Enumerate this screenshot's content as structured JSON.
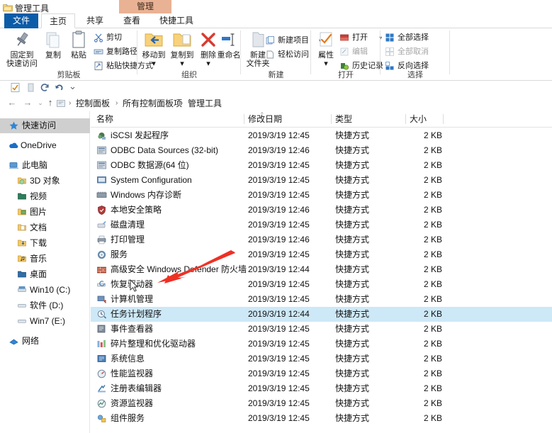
{
  "window": {
    "title": "管理工具",
    "icon": "folder-tools-icon",
    "contextual_tab_header": "管理",
    "contextual_tab_color": "#e9b294"
  },
  "ribbon": {
    "tabs": [
      {
        "label": "文件",
        "name": "tab-file",
        "state": "accent"
      },
      {
        "label": "主页",
        "name": "tab-home",
        "state": "active"
      },
      {
        "label": "共享",
        "name": "tab-share",
        "state": "normal"
      },
      {
        "label": "查看",
        "name": "tab-view",
        "state": "normal"
      },
      {
        "label": "快捷工具",
        "name": "tab-shortcut-tools",
        "state": "normal"
      }
    ],
    "groups": [
      {
        "label": "剪贴板",
        "big_buttons": [
          {
            "label_line1": "固定到",
            "label_line2": "快速访问",
            "icon": "pin-icon"
          },
          {
            "label_line1": "复制",
            "label_line2": "",
            "icon": "copy-icon"
          },
          {
            "label_line1": "粘贴",
            "label_line2": "",
            "icon": "paste-icon"
          }
        ],
        "small_buttons": [
          {
            "label": "剪切",
            "icon": "scissors-icon",
            "disabled": false
          },
          {
            "label": "复制路径",
            "icon": "copy-path-icon",
            "disabled": false
          },
          {
            "label": "粘贴快捷方式",
            "icon": "paste-shortcut-icon",
            "disabled": false
          }
        ]
      },
      {
        "label": "组织",
        "big_buttons": [
          {
            "label_line1": "移动到",
            "label_line2": "",
            "icon": "move-to-icon",
            "has_caret": true
          },
          {
            "label_line1": "复制到",
            "label_line2": "",
            "icon": "copy-to-icon",
            "has_caret": true
          },
          {
            "label_line1": "删除",
            "label_line2": "",
            "icon": "delete-icon",
            "has_caret": true
          },
          {
            "label_line1": "重命名",
            "label_line2": "",
            "icon": "rename-icon",
            "has_caret": false
          }
        ],
        "small_buttons": []
      },
      {
        "label": "新建",
        "big_buttons": [
          {
            "label_line1": "新建",
            "label_line2": "文件夹",
            "icon": "new-folder-icon"
          }
        ],
        "small_buttons": [
          {
            "label": "新建项目",
            "icon": "new-item-icon",
            "disabled": false,
            "has_caret": true
          },
          {
            "label": "轻松访问",
            "icon": "easy-access-icon",
            "disabled": false,
            "has_caret": true
          }
        ]
      },
      {
        "label": "打开",
        "big_buttons": [
          {
            "label_line1": "属性",
            "label_line2": "",
            "icon": "properties-icon",
            "has_caret": true
          }
        ],
        "small_buttons": [
          {
            "label": "打开",
            "icon": "open-icon",
            "disabled": false,
            "has_caret": true
          },
          {
            "label": "编辑",
            "icon": "edit-icon",
            "disabled": true
          },
          {
            "label": "历史记录",
            "icon": "history-icon",
            "disabled": false
          }
        ]
      },
      {
        "label": "选择",
        "big_buttons": [],
        "small_buttons": [
          {
            "label": "全部选择",
            "icon": "select-all-icon",
            "disabled": false
          },
          {
            "label": "全部取消",
            "icon": "select-none-icon",
            "disabled": true
          },
          {
            "label": "反向选择",
            "icon": "invert-selection-icon",
            "disabled": false
          }
        ]
      }
    ]
  },
  "quick_access_toolbar": {
    "items": [
      {
        "name": "properties-qat-icon",
        "icon": "properties-check-icon"
      },
      {
        "name": "new-folder-qat-icon",
        "icon": "new-folder-icon"
      },
      {
        "name": "redo-qat-icon",
        "icon": "redo-icon"
      },
      {
        "name": "undo-qat-icon",
        "icon": "undo-icon"
      },
      {
        "name": "customize-qat-icon",
        "icon": "chevron-down-icon"
      }
    ]
  },
  "address_bar": {
    "back": "←",
    "forward": "→",
    "recent": "⌄",
    "up": "↑",
    "path_icon": "control-panel-icon",
    "crumbs": [
      "控制面板",
      "所有控制面板项",
      "管理工具"
    ],
    "separator": "›"
  },
  "sidebar": {
    "items": [
      {
        "label": "快速访问",
        "icon": "star-icon",
        "indent": 0,
        "selected": true
      },
      {
        "label": "OneDrive",
        "icon": "cloud-icon",
        "indent": 0,
        "selected": false
      },
      {
        "label": "此电脑",
        "icon": "computer-icon",
        "indent": 0,
        "selected": false
      },
      {
        "label": "3D 对象",
        "icon": "folder-3d-icon",
        "indent": 1,
        "selected": false
      },
      {
        "label": "视频",
        "icon": "folder-videos-icon",
        "indent": 1,
        "selected": false
      },
      {
        "label": "图片",
        "icon": "folder-pictures-icon",
        "indent": 1,
        "selected": false
      },
      {
        "label": "文档",
        "icon": "folder-documents-icon",
        "indent": 1,
        "selected": false
      },
      {
        "label": "下载",
        "icon": "folder-downloads-icon",
        "indent": 1,
        "selected": false
      },
      {
        "label": "音乐",
        "icon": "folder-music-icon",
        "indent": 1,
        "selected": false
      },
      {
        "label": "桌面",
        "icon": "folder-desktop-icon",
        "indent": 1,
        "selected": false
      },
      {
        "label": "Win10 (C:)",
        "icon": "drive-system-icon",
        "indent": 1,
        "selected": false
      },
      {
        "label": "软件 (D:)",
        "icon": "drive-icon",
        "indent": 1,
        "selected": false
      },
      {
        "label": "Win7 (E:)",
        "icon": "drive-icon",
        "indent": 1,
        "selected": false
      },
      {
        "label": "网络",
        "icon": "network-icon",
        "indent": 0,
        "selected": false
      }
    ]
  },
  "columns": [
    {
      "label": "名称",
      "name": "column-name"
    },
    {
      "label": "修改日期",
      "name": "column-date-modified"
    },
    {
      "label": "类型",
      "name": "column-type"
    },
    {
      "label": "大小",
      "name": "column-size"
    }
  ],
  "files": [
    {
      "name": "iSCSI 发起程序",
      "date": "2019/3/19 12:45",
      "type": "快捷方式",
      "size": "2 KB",
      "icon": "iscsi-icon",
      "selected": false
    },
    {
      "name": "ODBC Data Sources (32-bit)",
      "date": "2019/3/19 12:46",
      "type": "快捷方式",
      "size": "2 KB",
      "icon": "odbc-icon",
      "selected": false
    },
    {
      "name": "ODBC 数据源(64 位)",
      "date": "2019/3/19 12:45",
      "type": "快捷方式",
      "size": "2 KB",
      "icon": "odbc-icon",
      "selected": false
    },
    {
      "name": "System Configuration",
      "date": "2019/3/19 12:45",
      "type": "快捷方式",
      "size": "2 KB",
      "icon": "msconfig-icon",
      "selected": false
    },
    {
      "name": "Windows 内存诊断",
      "date": "2019/3/19 12:45",
      "type": "快捷方式",
      "size": "2 KB",
      "icon": "memory-diagnostic-icon",
      "selected": false
    },
    {
      "name": "本地安全策略",
      "date": "2019/3/19 12:46",
      "type": "快捷方式",
      "size": "2 KB",
      "icon": "local-security-policy-icon",
      "selected": false
    },
    {
      "name": "磁盘清理",
      "date": "2019/3/19 12:45",
      "type": "快捷方式",
      "size": "2 KB",
      "icon": "disk-cleanup-icon",
      "selected": false
    },
    {
      "name": "打印管理",
      "date": "2019/3/19 12:46",
      "type": "快捷方式",
      "size": "2 KB",
      "icon": "print-management-icon",
      "selected": false
    },
    {
      "name": "服务",
      "date": "2019/3/19 12:45",
      "type": "快捷方式",
      "size": "2 KB",
      "icon": "services-icon",
      "selected": false
    },
    {
      "name": "高级安全 Windows Defender 防火墙",
      "date": "2019/3/19 12:44",
      "type": "快捷方式",
      "size": "2 KB",
      "icon": "firewall-icon",
      "selected": false
    },
    {
      "name": "恢复驱动器",
      "date": "2019/3/19 12:45",
      "type": "快捷方式",
      "size": "2 KB",
      "icon": "recovery-drive-icon",
      "selected": false
    },
    {
      "name": "计算机管理",
      "date": "2019/3/19 12:45",
      "type": "快捷方式",
      "size": "2 KB",
      "icon": "computer-management-icon",
      "selected": false
    },
    {
      "name": "任务计划程序",
      "date": "2019/3/19 12:44",
      "type": "快捷方式",
      "size": "2 KB",
      "icon": "task-scheduler-icon",
      "selected": true
    },
    {
      "name": "事件查看器",
      "date": "2019/3/19 12:45",
      "type": "快捷方式",
      "size": "2 KB",
      "icon": "event-viewer-icon",
      "selected": false
    },
    {
      "name": "碎片整理和优化驱动器",
      "date": "2019/3/19 12:45",
      "type": "快捷方式",
      "size": "2 KB",
      "icon": "defrag-icon",
      "selected": false
    },
    {
      "name": "系统信息",
      "date": "2019/3/19 12:45",
      "type": "快捷方式",
      "size": "2 KB",
      "icon": "system-info-icon",
      "selected": false
    },
    {
      "name": "性能监视器",
      "date": "2019/3/19 12:45",
      "type": "快捷方式",
      "size": "2 KB",
      "icon": "performance-monitor-icon",
      "selected": false
    },
    {
      "name": "注册表编辑器",
      "date": "2019/3/19 12:45",
      "type": "快捷方式",
      "size": "2 KB",
      "icon": "regedit-icon",
      "selected": false
    },
    {
      "name": "资源监视器",
      "date": "2019/3/19 12:45",
      "type": "快捷方式",
      "size": "2 KB",
      "icon": "resource-monitor-icon",
      "selected": false
    },
    {
      "name": "组件服务",
      "date": "2019/3/19 12:45",
      "type": "快捷方式",
      "size": "2 KB",
      "icon": "component-services-icon",
      "selected": false
    }
  ],
  "annotation": {
    "arrow_color": "#ee3124",
    "target": "任务计划程序"
  }
}
